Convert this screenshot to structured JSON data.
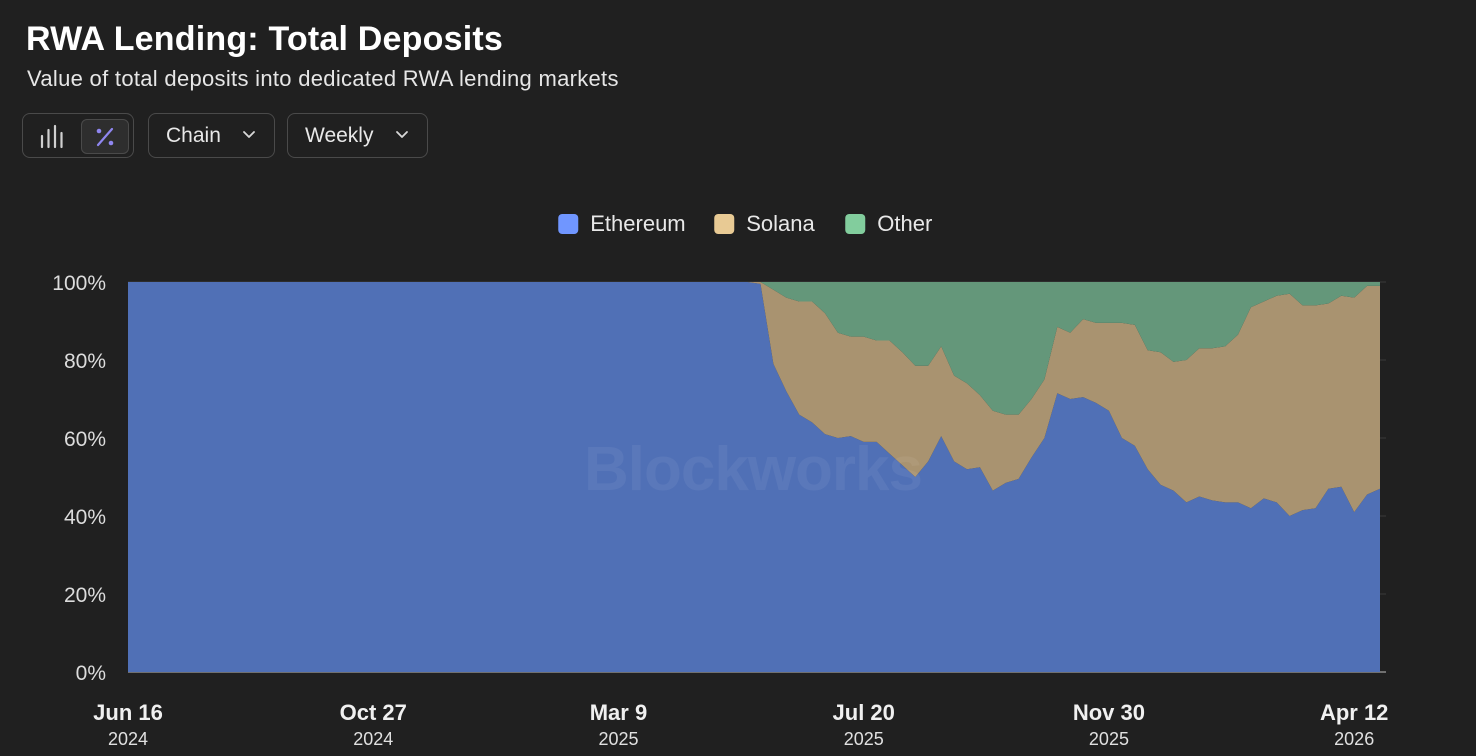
{
  "header": {
    "title": "RWA Lending: Total Deposits",
    "subtitle": "Value of total deposits into dedicated RWA lending markets"
  },
  "toolbar": {
    "chart_type_buttons": [
      {
        "icon": "bar-chart-icon",
        "active": false
      },
      {
        "icon": "percent-icon",
        "active": true
      }
    ],
    "chain_label": "Chain",
    "interval_label": "Weekly"
  },
  "watermark": "Blockworks",
  "colors": {
    "background": "#202020",
    "Ethereum": "#5070B6",
    "Solana": "#A99370",
    "Other": "#64977A",
    "legend_Ethereum": "#7096FF",
    "legend_Solana": "#E8CA94",
    "legend_Other": "#82CD9D",
    "accent": "#8F86F0"
  },
  "chart_data": {
    "type": "area",
    "stacked": true,
    "normalized": true,
    "title": "RWA Lending: Total Deposits",
    "subtitle": "Value of total deposits into dedicated RWA lending markets",
    "x": [
      "2024-06-16",
      "2024-06-23",
      "2024-06-30",
      "2024-07-07",
      "2024-07-14",
      "2024-07-21",
      "2024-07-28",
      "2024-08-04",
      "2024-08-11",
      "2024-08-18",
      "2024-08-25",
      "2024-09-01",
      "2024-09-08",
      "2024-09-15",
      "2024-09-22",
      "2024-09-29",
      "2024-10-06",
      "2024-10-13",
      "2024-10-20",
      "2024-10-27",
      "2024-11-03",
      "2024-11-10",
      "2024-11-17",
      "2024-11-24",
      "2024-12-01",
      "2024-12-08",
      "2024-12-15",
      "2024-12-22",
      "2024-12-29",
      "2025-01-05",
      "2025-01-12",
      "2025-01-19",
      "2025-01-26",
      "2025-02-02",
      "2025-02-09",
      "2025-02-16",
      "2025-02-23",
      "2025-03-02",
      "2025-03-09",
      "2025-03-16",
      "2025-03-23",
      "2025-03-30",
      "2025-04-06",
      "2025-04-13",
      "2025-04-20",
      "2025-04-27",
      "2025-05-04",
      "2025-05-11",
      "2025-05-18",
      "2025-05-25",
      "2025-06-01",
      "2025-06-08",
      "2025-06-15",
      "2025-06-22",
      "2025-06-29",
      "2025-07-06",
      "2025-07-13",
      "2025-07-20",
      "2025-07-27",
      "2025-08-03",
      "2025-08-10",
      "2025-08-17",
      "2025-08-24",
      "2025-08-31",
      "2025-09-07",
      "2025-09-14",
      "2025-09-21",
      "2025-09-28",
      "2025-10-05",
      "2025-10-12",
      "2025-10-19",
      "2025-10-26",
      "2025-11-02",
      "2025-11-09",
      "2025-11-16",
      "2025-11-23",
      "2025-11-30",
      "2025-12-07",
      "2025-12-14",
      "2025-12-21",
      "2025-12-28",
      "2026-01-04",
      "2026-01-11",
      "2026-01-18",
      "2026-01-25",
      "2026-02-01",
      "2026-02-08",
      "2026-02-15",
      "2026-02-22",
      "2026-03-01",
      "2026-03-08",
      "2026-03-15",
      "2026-03-22",
      "2026-03-29",
      "2026-04-05",
      "2026-04-12",
      "2026-04-19",
      "2026-04-26"
    ],
    "series": [
      {
        "name": "Ethereum",
        "values": [
          100,
          100,
          100,
          100,
          100,
          100,
          100,
          100,
          100,
          100,
          100,
          100,
          100,
          100,
          100,
          100,
          100,
          100,
          100,
          100,
          100,
          100,
          100,
          100,
          100,
          100,
          100,
          100,
          100,
          100,
          100,
          100,
          100,
          100,
          100,
          100,
          100,
          100,
          100,
          100,
          100,
          100,
          100,
          100,
          100,
          100,
          100,
          100,
          100,
          99.5,
          79,
          72,
          66,
          64,
          61,
          60,
          60.5,
          59,
          59,
          56,
          53,
          50,
          54,
          60.5,
          54,
          52,
          52.5,
          46.5,
          48.5,
          49.5,
          55,
          60,
          71.5,
          70,
          70.5,
          69,
          67,
          60,
          58,
          52,
          48,
          46.5,
          43.5,
          45,
          44,
          43.5,
          43.5,
          42,
          44.5,
          43.5,
          40,
          41.5,
          42,
          47,
          47.5,
          41,
          45.5,
          47
        ]
      },
      {
        "name": "Solana",
        "values": [
          0,
          0,
          0,
          0,
          0,
          0,
          0,
          0,
          0,
          0,
          0,
          0,
          0,
          0,
          0,
          0,
          0,
          0,
          0,
          0,
          0,
          0,
          0,
          0,
          0,
          0,
          0,
          0,
          0,
          0,
          0,
          0,
          0,
          0,
          0,
          0,
          0,
          0,
          0,
          0,
          0,
          0,
          0,
          0,
          0,
          0,
          0,
          0,
          0,
          0.5,
          19,
          24,
          29,
          31,
          31,
          27,
          25.5,
          27,
          26,
          29,
          29,
          28.5,
          24.5,
          23,
          22,
          22,
          18.5,
          20.5,
          17.5,
          16.5,
          15,
          15,
          17,
          17,
          20,
          20.5,
          22.5,
          29.5,
          31,
          30.5,
          34,
          33,
          36.5,
          38,
          39,
          40,
          43,
          51.5,
          50.5,
          53,
          57,
          52.5,
          52,
          47.5,
          49,
          55,
          53.5,
          52
        ]
      },
      {
        "name": "Other",
        "values": [
          0,
          0,
          0,
          0,
          0,
          0,
          0,
          0,
          0,
          0,
          0,
          0,
          0,
          0,
          0,
          0,
          0,
          0,
          0,
          0,
          0,
          0,
          0,
          0,
          0,
          0,
          0,
          0,
          0,
          0,
          0,
          0,
          0,
          0,
          0,
          0,
          0,
          0,
          0,
          0,
          0,
          0,
          0,
          0,
          0,
          0,
          0,
          0,
          0,
          0,
          2,
          4,
          5,
          5,
          8,
          13,
          14,
          14,
          15,
          15,
          18,
          21.5,
          21.5,
          16.5,
          24,
          26,
          29,
          33,
          34,
          34,
          30,
          25,
          11.5,
          13,
          9.5,
          10.5,
          10.5,
          10.5,
          11,
          17.5,
          18,
          20.5,
          20,
          17,
          17,
          16.5,
          13.5,
          6.5,
          5,
          3.5,
          3,
          6,
          6,
          5.5,
          3.5,
          4,
          1,
          1
        ]
      }
    ],
    "yticks": [
      "0%",
      "20%",
      "40%",
      "60%",
      "80%",
      "100%"
    ],
    "ylim": [
      0,
      100
    ],
    "xticks": [
      {
        "label": "Jun 16",
        "year": "2024",
        "date": "2024-06-16"
      },
      {
        "label": "Oct 27",
        "year": "2024",
        "date": "2024-10-27"
      },
      {
        "label": "Mar 9",
        "year": "2025",
        "date": "2025-03-09"
      },
      {
        "label": "Jul 20",
        "year": "2025",
        "date": "2025-07-20"
      },
      {
        "label": "Nov 30",
        "year": "2025",
        "date": "2025-11-30"
      },
      {
        "label": "Apr 12",
        "year": "2026",
        "date": "2026-04-12"
      }
    ],
    "legend": [
      "Ethereum",
      "Solana",
      "Other"
    ],
    "legend_position": "top-center",
    "grid": true
  }
}
